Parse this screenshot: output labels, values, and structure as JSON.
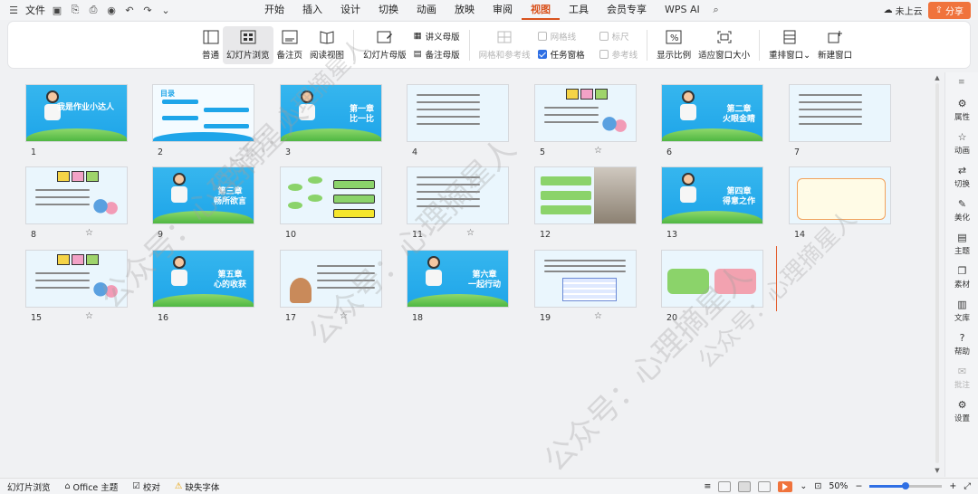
{
  "titlebar": {
    "file_label": "文件",
    "menus": [
      "开始",
      "插入",
      "设计",
      "切换",
      "动画",
      "放映",
      "审阅",
      "视图",
      "工具",
      "会员专享",
      "WPS AI"
    ],
    "active_menu": "视图",
    "cloud_label": "未上云",
    "share_label": "分享"
  },
  "ribbon": {
    "view_buttons": [
      "普通",
      "幻灯片浏览",
      "备注页",
      "阅读视图"
    ],
    "active_view": "幻灯片浏览",
    "master_buttons": [
      "幻灯片母版"
    ],
    "master_small": [
      "讲义母版",
      "备注母版"
    ],
    "grid_label": "网格和参考线",
    "checks": [
      {
        "label": "网格线",
        "checked": false,
        "disabled": true
      },
      {
        "label": "任务窗格",
        "checked": true,
        "disabled": false
      },
      {
        "label": "标尺",
        "checked": false,
        "disabled": true
      },
      {
        "label": "参考线",
        "checked": false,
        "disabled": true
      }
    ],
    "zoom_buttons": [
      "显示比例",
      "适应窗口大小"
    ],
    "window_buttons": [
      "重排窗口",
      "新建窗口"
    ]
  },
  "slides": [
    {
      "n": "1",
      "kind": "cover",
      "title": "我是作业小达人"
    },
    {
      "n": "2",
      "kind": "toc",
      "title": "目录"
    },
    {
      "n": "3",
      "kind": "chapter",
      "title": "第一章\n比一比"
    },
    {
      "n": "4",
      "kind": "content"
    },
    {
      "n": "5",
      "kind": "pills"
    },
    {
      "n": "6",
      "kind": "chapter",
      "title": "第二章\n火眼金睛"
    },
    {
      "n": "7",
      "kind": "content"
    },
    {
      "n": "8",
      "kind": "pills"
    },
    {
      "n": "9",
      "kind": "chapter",
      "title": "第三章\n畅所欲言"
    },
    {
      "n": "10",
      "kind": "mindmap"
    },
    {
      "n": "11",
      "kind": "content"
    },
    {
      "n": "12",
      "kind": "photo"
    },
    {
      "n": "13",
      "kind": "chapter",
      "title": "第四章\n得意之作"
    },
    {
      "n": "14",
      "kind": "form"
    },
    {
      "n": "15",
      "kind": "pills"
    },
    {
      "n": "16",
      "kind": "chapter",
      "title": "第五章\n心的收获"
    },
    {
      "n": "17",
      "kind": "letter"
    },
    {
      "n": "18",
      "kind": "chapter",
      "title": "第六章\n一起行动"
    },
    {
      "n": "19",
      "kind": "table"
    },
    {
      "n": "20",
      "kind": "plan"
    }
  ],
  "animated_slides": [
    "5",
    "8",
    "11",
    "15",
    "17",
    "19"
  ],
  "right_panel": [
    "属性",
    "动画",
    "切换",
    "美化",
    "主题",
    "素材",
    "文库",
    "帮助",
    "批注",
    "设置"
  ],
  "status": {
    "view_name": "幻灯片浏览",
    "theme": "Office 主题",
    "proof": "校对",
    "missing_font": "缺失字体",
    "zoom": "50%",
    "zoom_fraction": 0.5
  },
  "watermark": "公众号：心理摘星人",
  "colors": {
    "accent": "#d9531e",
    "share": "#f0733c",
    "slide_blue": "#1ea5e9"
  }
}
